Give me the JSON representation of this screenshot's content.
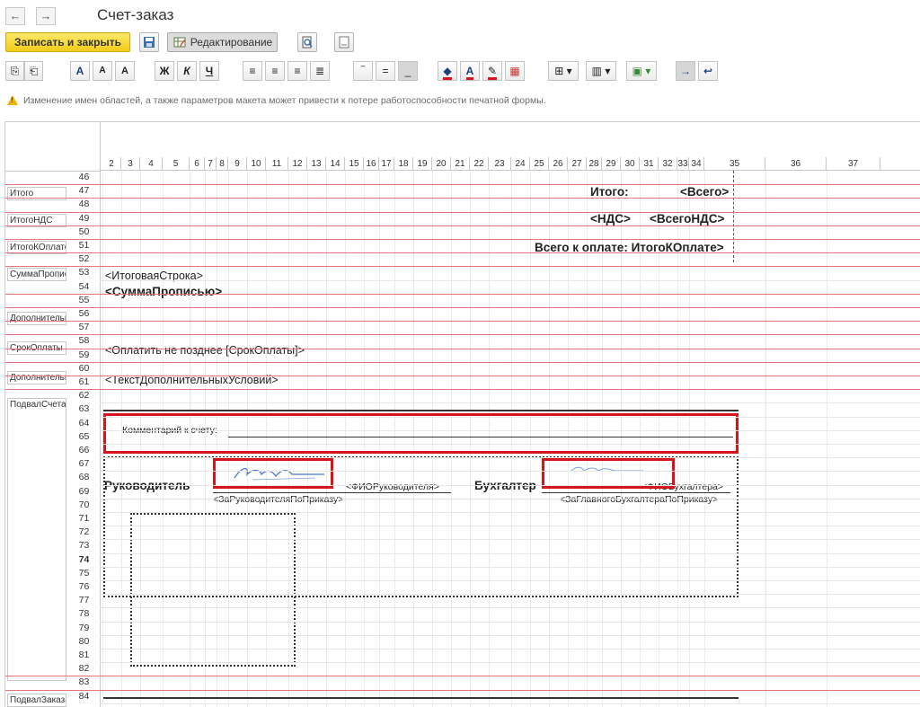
{
  "window": {
    "title": "Счет-заказ",
    "back_glyph": "←",
    "forward_glyph": "→"
  },
  "commands": {
    "save_close": "Записать и закрыть",
    "editing": "Редактирование"
  },
  "format_toolbar": {
    "font_a": "A",
    "font_bigger": "A",
    "font_smaller": "A",
    "bold": "Ж",
    "italic": "К",
    "underline": "Ч"
  },
  "warning": "Изменение имен областей, а также параметров макета может привести к потере работоспособности печатной формы.",
  "columns": [
    "2",
    "3",
    "4",
    "5",
    "6",
    "7",
    "8",
    "9",
    "10",
    "11",
    "12",
    "13",
    "14",
    "15",
    "16",
    "17",
    "18",
    "19",
    "20",
    "21",
    "22",
    "23",
    "24",
    "25",
    "26",
    "27",
    "28",
    "29",
    "30",
    "31",
    "32",
    "33",
    "34",
    "35",
    "36",
    "37"
  ],
  "rows": [
    "46",
    "47",
    "48",
    "49",
    "50",
    "51",
    "52",
    "53",
    "54",
    "55",
    "56",
    "57",
    "58",
    "59",
    "60",
    "61",
    "62",
    "63",
    "64",
    "65",
    "66",
    "67",
    "68",
    "69",
    "70",
    "71",
    "72",
    "73",
    "74",
    "75",
    "76",
    "77",
    "78",
    "79",
    "80",
    "81",
    "82",
    "83",
    "84"
  ],
  "current_row": "74",
  "areas": {
    "itogo": "Итого",
    "itogo_nds": "ИтогоНДС",
    "itogo_k_oplate": "ИтогоКОплате",
    "summa_propisyu": "СуммаПрописью",
    "dop1": "ДополнительнаяИнформация",
    "srok": "СрокОплаты",
    "dop2": "ДополнительныеУсловия",
    "podval_scheta": "ПодвалСчета",
    "podval_zakaza": "ПодвалЗаказа"
  },
  "cells": {
    "itogo_label": "Итого:",
    "itogo_value": "<Всего>",
    "nds_label": "<НДС>",
    "nds_value": "<ВсегоНДС>",
    "k_oplate": "Всего к оплате: ИтогоКОплате>",
    "itog_stroka": "<ИтоговаяСтрока>",
    "summa_propisyu": "<СуммаПрописью>",
    "oplatit": "<Оплатить не позднее [СрокОплаты]>",
    "tekst_usloviy": "<ТекстДополнительныхУсловий>",
    "kommentariy": "Комментарий к счету:",
    "rukovoditel": "Руководитель",
    "fio_rukovoditelya": "<ФИОРуководителя>",
    "za_rukovoditelya": "<ЗаРуководителяПоПриказу>",
    "buhgalter": "Бухгалтер",
    "fio_buhgaltera": "<ФИОБухгалтера>",
    "za_glavnogo": "<ЗаГлавногоБухгалтераПоПриказу>"
  }
}
